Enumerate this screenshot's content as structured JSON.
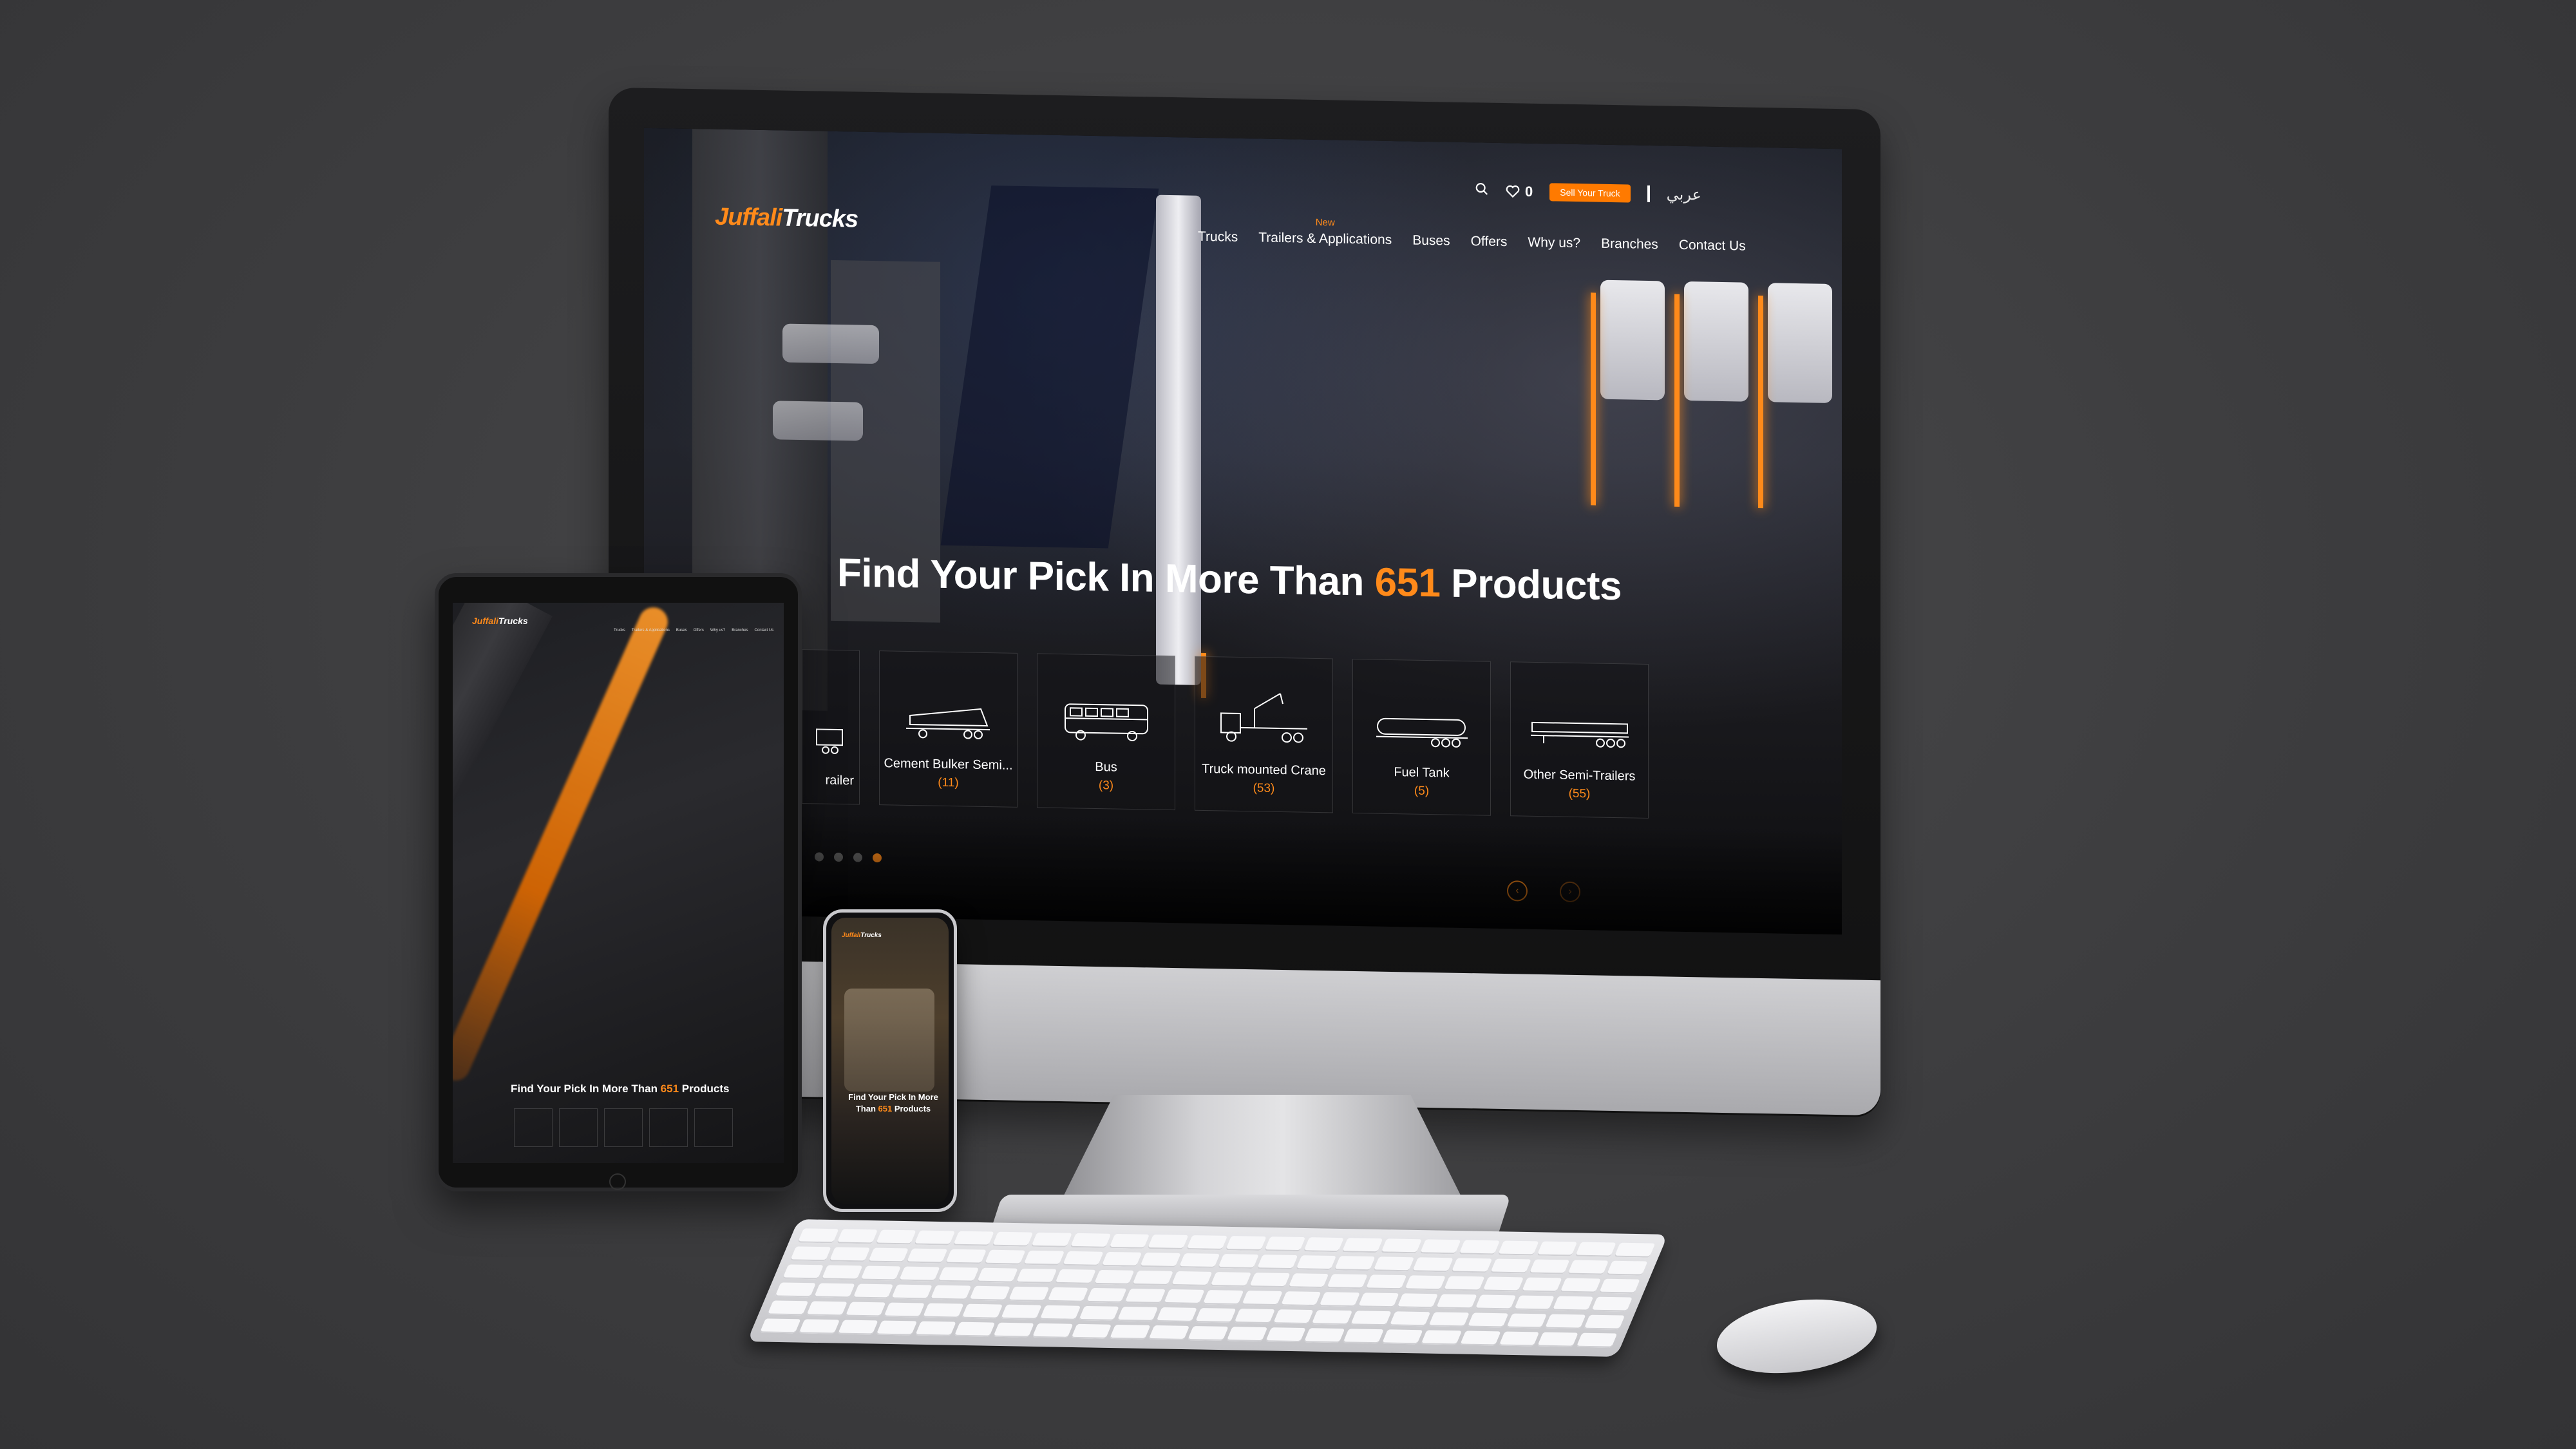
{
  "brand": {
    "part1": "Juffali",
    "part2": "Trucks",
    "accent": "#ff8a1a"
  },
  "topbar": {
    "wishlist_count": "0",
    "sell_button": "Sell Your Truck",
    "language": "عربي"
  },
  "nav": {
    "items": [
      {
        "label": "Trucks",
        "badge": ""
      },
      {
        "label": "Trailers & Applications",
        "badge": "New"
      },
      {
        "label": "Buses",
        "badge": ""
      },
      {
        "label": "Offers",
        "badge": ""
      },
      {
        "label": "Why us?",
        "badge": ""
      },
      {
        "label": "Branches",
        "badge": ""
      },
      {
        "label": "Contact Us",
        "badge": ""
      }
    ]
  },
  "hero": {
    "title_prefix": "Find Your Pick In More Than ",
    "count": "651",
    "title_suffix": " Products"
  },
  "categories": [
    {
      "label": "railer",
      "count": ""
    },
    {
      "label": "Cement Bulker Semi...",
      "count": "(11)"
    },
    {
      "label": "Bus",
      "count": "(3)"
    },
    {
      "label": "Truck mounted Crane",
      "count": "(53)"
    },
    {
      "label": "Fuel Tank",
      "count": "(5)"
    },
    {
      "label": "Other Semi-Trailers",
      "count": "(55)"
    }
  ],
  "carousel": {
    "active_index": 3,
    "total": 4
  },
  "tablet": {
    "title_prefix": "Find Your Pick In More Than ",
    "count": "651",
    "title_suffix": " Products",
    "nav": [
      "Trucks",
      "Trailers & Applications",
      "Buses",
      "Offers",
      "Why us?",
      "Branches",
      "Contact Us"
    ]
  },
  "phone": {
    "title_line1": "Find Your Pick In More",
    "title_line2_prefix": "Than ",
    "count": "651",
    "title_line2_suffix": " Products"
  },
  "icons": {
    "search": "search-icon",
    "heart": "heart-icon",
    "prev": "chevron-left-icon",
    "next": "chevron-right-icon"
  }
}
